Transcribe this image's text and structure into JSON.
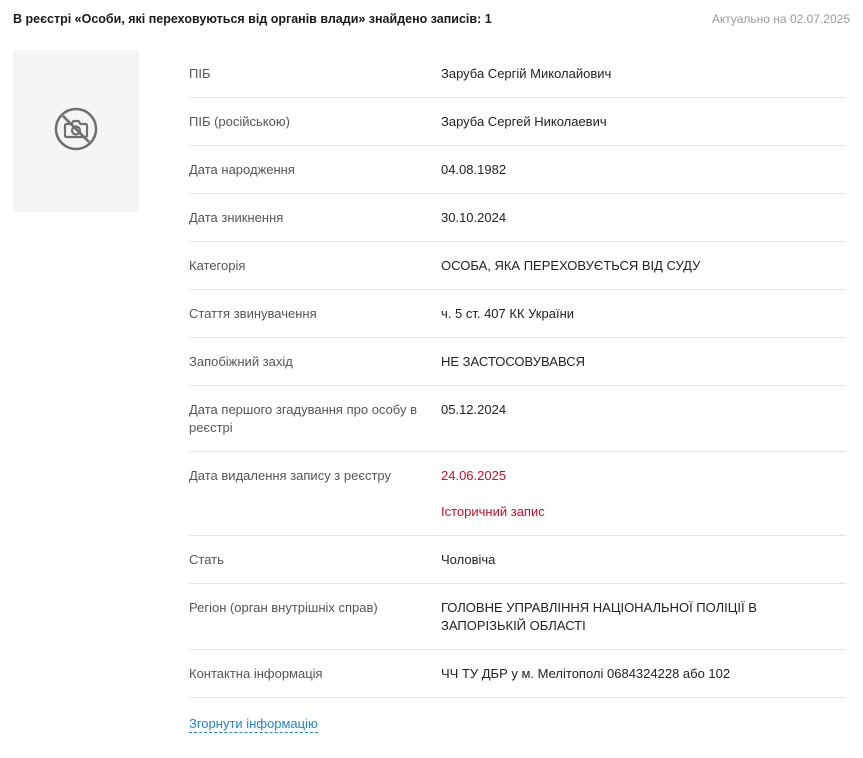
{
  "header": {
    "title": "В реєстрі «Особи, які переховуються від органів влади» знайдено записів: 1",
    "actual_date": "Актуально на 02.07.2025"
  },
  "photo": {
    "icon": "no-photo-icon"
  },
  "rows": [
    {
      "label": "ПІБ",
      "value": "Заруба Сергій Миколайович"
    },
    {
      "label": "ПІБ (російською)",
      "value": "Заруба Сергей Николаевич"
    },
    {
      "label": "Дата народження",
      "value": "04.08.1982"
    },
    {
      "label": "Дата зникнення",
      "value": "30.10.2024"
    },
    {
      "label": "Категорія",
      "value": "ОСОБА, ЯКА ПЕРЕХОВУЄТЬСЯ ВІД СУДУ"
    },
    {
      "label": "Стаття звинувачення",
      "value": "ч. 5 ст. 407 КК України"
    },
    {
      "label": "Запобіжний захід",
      "value": "НЕ ЗАСТОСОВУВАВСЯ"
    },
    {
      "label": "Дата першого згадування про особу в реєстрі",
      "value": "05.12.2024"
    },
    {
      "label": "Дата видалення запису з реєстру",
      "value": "24.06.2025",
      "note": "Історичний запис"
    },
    {
      "label": "Стать",
      "value": "Чоловіча"
    },
    {
      "label": "Регіон (орган внутрішніх справ)",
      "value": "ГОЛОВНЕ УПРАВЛІННЯ НАЦІОНАЛЬНОЇ ПОЛІЦІЇ В ЗАПОРІЗЬКІЙ ОБЛАСТІ"
    },
    {
      "label": "Контактна інформація",
      "value": "ЧЧ ТУ ДБР у м. Мелітополі 0684324228 або 102"
    }
  ],
  "collapse_label": "Згорнути інформацію",
  "colors": {
    "link": "#1f86c8",
    "alert": "#c0102b",
    "photo_bg": "#f5f5f5"
  }
}
